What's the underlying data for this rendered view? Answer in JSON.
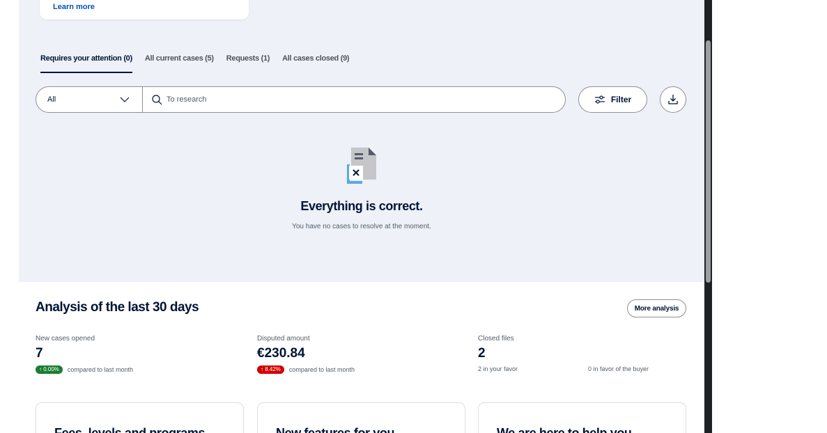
{
  "learn_card": {
    "link": "Learn more"
  },
  "tabs": [
    {
      "label": "Requires your attention (0)"
    },
    {
      "label": "All current cases (5)"
    },
    {
      "label": "Requests (1)"
    },
    {
      "label": "All cases closed (9)"
    }
  ],
  "search": {
    "select_value": "All",
    "placeholder": "To research",
    "filter_label": "Filter"
  },
  "empty_state": {
    "title": "Everything is correct.",
    "subtitle": "You have no cases to resolve at the moment."
  },
  "analysis": {
    "title": "Analysis of the last 30 days",
    "more_button": "More analysis",
    "metrics": {
      "new_cases": {
        "label": "New cases opened",
        "value": "7",
        "change": "0.00%",
        "compare_text": "compared to last month",
        "change_color": "#1a7d30"
      },
      "disputed": {
        "label": "Disputed amount",
        "value": "€230.84",
        "change": "8.42%",
        "compare_text": "compared to last month",
        "change_color": "#d20000"
      },
      "closed": {
        "label": "Closed files",
        "value": "2",
        "in_favor": "2 in your favor",
        "buyer_favor": "0 in favor of the buyer"
      }
    }
  },
  "cards": [
    {
      "title": "Fees, levels and programs"
    },
    {
      "title": "New features for you"
    },
    {
      "title": "We are here to help you"
    }
  ],
  "colors": {
    "accent": "#0551b5",
    "background": "#eef1f8",
    "text": "#001435"
  }
}
